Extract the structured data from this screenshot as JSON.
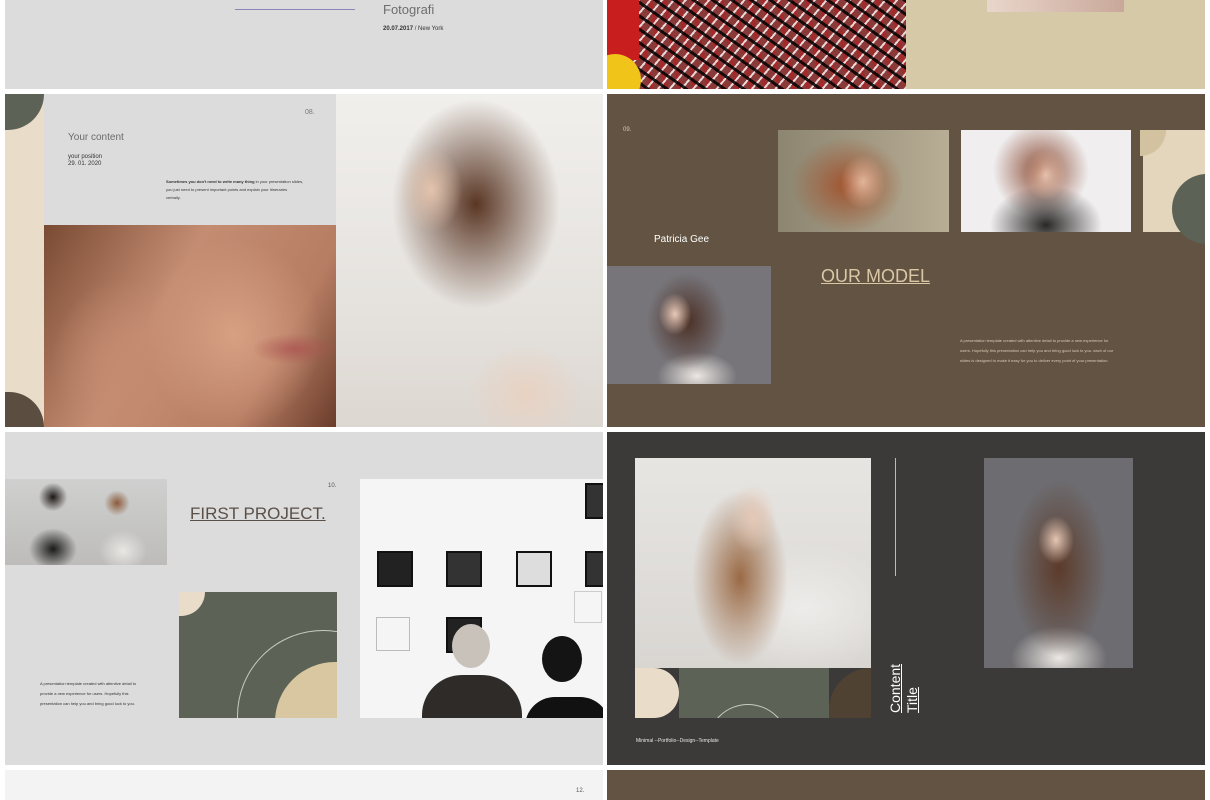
{
  "slide_top_left": {
    "title": "Fotografi",
    "date": "20.07.2017",
    "location": "New York"
  },
  "slide_08": {
    "number": "08.",
    "heading": "Your content",
    "position_label": "your position",
    "date": "29. 01. 2020",
    "body_bold": "Sometimes you don't need to write many thing",
    "body_rest_1": " in your presentation slides,",
    "body_line_2": "you just need to present important points and explain your itineraries",
    "body_line_3": "verbally."
  },
  "slide_09": {
    "number": "09.",
    "model_name": "Patricia Gee",
    "title": "OUR MODEL",
    "body_1": "A presentation template created with attentive detail to provide a new experience for",
    "body_2": "users. Hopefully this presentation can help you and bring good luck to you. each of our",
    "body_3": "slides is designed to make it easy for you to deliver every point of your presentation."
  },
  "slide_10": {
    "number": "10.",
    "title": "FIRST PROJECT.",
    "body_1": "A presentation template created with attentive detail to",
    "body_2": "provide a new experience for users. Hopefully this",
    "body_3": "presentation can help you and bring good luck to you."
  },
  "slide_dark": {
    "vertical_title": "Content Title",
    "footer": "Minimal --Portfolio--Design--Template"
  },
  "slide_12": {
    "number": "12."
  },
  "colors": {
    "light_grey": "#dcdcdc",
    "beige": "#e9dcc8",
    "sand": "#d3c29f",
    "brown": "#625342",
    "olive": "#5c6356",
    "charcoal": "#3b3a39",
    "deep_brown": "#4f4233",
    "link_text": "#5a5048"
  }
}
